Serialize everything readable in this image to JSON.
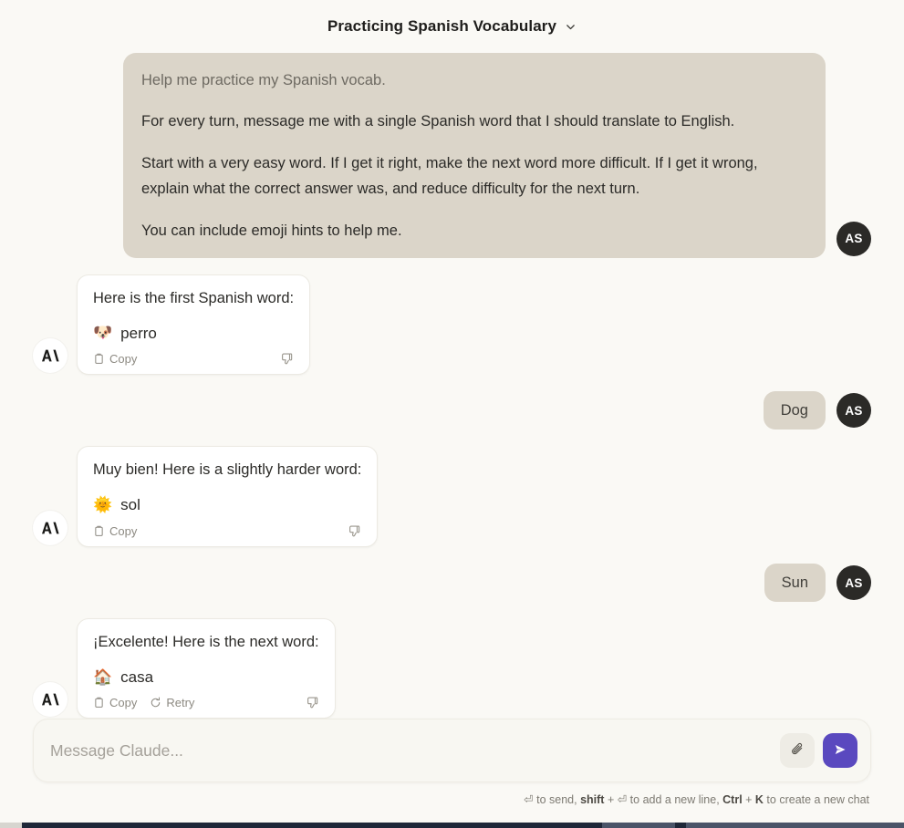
{
  "header": {
    "title": "Practicing Spanish Vocabulary",
    "chevron_icon": "chevron-down-icon"
  },
  "conversation": {
    "turns": [
      {
        "role": "user",
        "avatar_initials": "AS",
        "paragraphs": [
          "Help me practice my Spanish vocab.",
          "For every turn, message me with a single Spanish word that I should translate to English.",
          "Start with a very easy word. If I get it right, make the next word more difficult. If I get it wrong, explain what the correct answer was, and reduce difficulty for the next turn.",
          "You can include emoji hints to help me."
        ]
      },
      {
        "role": "assistant",
        "intro": "Here is the first Spanish word:",
        "emoji": "🐶",
        "emoji_name": "dog-face-emoji",
        "word": "perro",
        "actions": {
          "copy_label": "Copy",
          "copy_icon": "clipboard-icon",
          "thumbs_down_icon": "thumbs-down-icon"
        }
      },
      {
        "role": "user",
        "avatar_initials": "AS",
        "text": "Dog"
      },
      {
        "role": "assistant",
        "intro": "Muy bien! Here is a slightly harder word:",
        "emoji": "🌞",
        "emoji_name": "sun-with-face-emoji",
        "word": "sol",
        "actions": {
          "copy_label": "Copy",
          "copy_icon": "clipboard-icon",
          "thumbs_down_icon": "thumbs-down-icon"
        }
      },
      {
        "role": "user",
        "avatar_initials": "AS",
        "text": "Sun"
      },
      {
        "role": "assistant",
        "intro": "¡Excelente! Here is the next word:",
        "emoji": "🏠",
        "emoji_name": "house-emoji",
        "word": "casa",
        "actions": {
          "copy_label": "Copy",
          "copy_icon": "clipboard-icon",
          "retry_label": "Retry",
          "retry_icon": "retry-icon",
          "thumbs_down_icon": "thumbs-down-icon"
        }
      }
    ]
  },
  "composer": {
    "placeholder": "Message Claude...",
    "value": "",
    "attach_icon": "paperclip-icon",
    "send_icon": "send-arrow-icon",
    "hint": {
      "part1": " to send, ",
      "shift": "shift",
      "part2": " + ",
      "part3": " to add a new line, ",
      "ctrl": "Ctrl",
      "plus": " + ",
      "k": "K",
      "part4": " to create a new chat",
      "enter_glyph": "⏎"
    }
  },
  "colors": {
    "page_background": "#faf9f5",
    "user_bubble": "#dbd5c9",
    "assistant_bubble": "#ffffff",
    "send_button": "#5a49bf",
    "avatar_user": "#2b2a27"
  }
}
